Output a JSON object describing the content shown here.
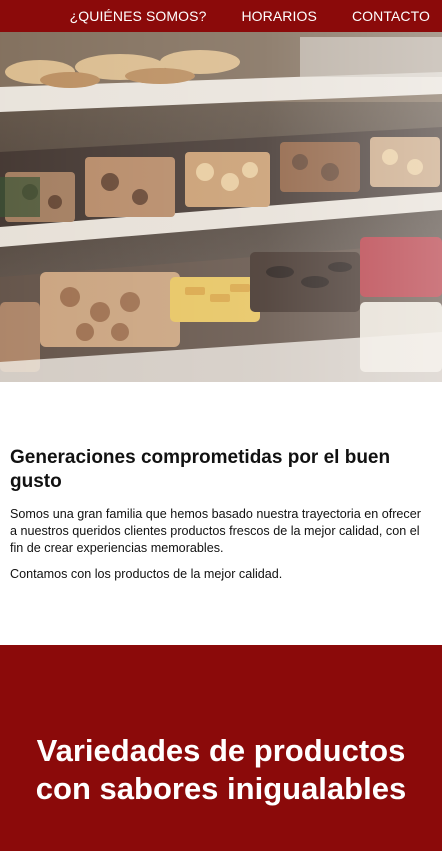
{
  "nav": {
    "items": [
      {
        "label": "¿QUIÉNES SOMOS?"
      },
      {
        "label": "HORARIOS"
      },
      {
        "label": "CONTACTO"
      }
    ]
  },
  "hero": {
    "image_subject": "pastry display case with trays of cookies"
  },
  "about": {
    "heading": "Generaciones comprometidas por el buen gusto",
    "paragraph1": "Somos una gran familia que hemos basado nuestra trayectoria en ofrecer a nuestros queridos clientes productos frescos de la mejor calidad, con el fin de crear experiencias memorables.",
    "paragraph2": "Contamos con los productos de la mejor calidad."
  },
  "promo": {
    "heading": "Variedades de productos con sabores inigualables"
  },
  "colors": {
    "brand": "#8b0a0a",
    "text": "#111111",
    "background": "#ffffff"
  }
}
